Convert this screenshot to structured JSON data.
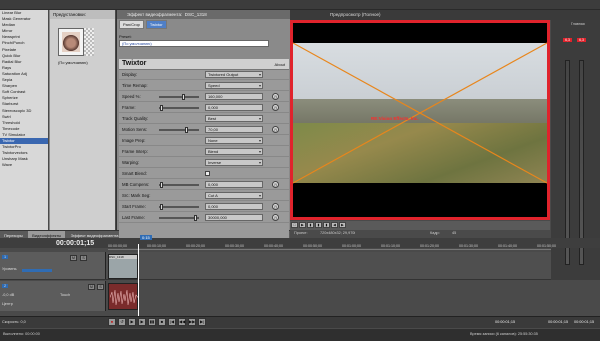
{
  "fx_list": {
    "items": [
      "Linear Blur",
      "Mask Generator",
      "Median",
      "Mirror",
      "Newsprint",
      "Pinch/Punch",
      "Pixelate",
      "Quick Blur",
      "Radial Blur",
      "Rays",
      "Saturation Adj",
      "Sepia",
      "Sharpen",
      "Soft Contrast",
      "Spherize",
      "Starburst",
      "Stereoscopic 3D",
      "Swirl",
      "Threshold",
      "Timecode",
      "TV Simulator",
      "Twixtor",
      "TwixtorPro",
      "Twixtorvectors",
      "Unsharp Mask",
      "Wave"
    ],
    "selected_index": 21
  },
  "presets_panel": {
    "header": "Предустановки:",
    "thumbnail_label": "(По умолчанию)"
  },
  "left_tabs": [
    "Перехоры",
    "Видеоэффекты",
    "Эффект видеофрагмента",
    "Обрезки"
  ],
  "plugin_panel": {
    "title_prefix": "Эффект видеофрагмента:",
    "title_clip": "DSC_1318",
    "chain": [
      "Pan/Crop",
      "Twixtor"
    ],
    "preset_label": "Preset:",
    "preset_value": "(По умолчанию)",
    "plugin_name": "Twixtor",
    "about_label": "About",
    "params": [
      {
        "label": "Display:",
        "value": "Twixtored Output",
        "type": "dropdown"
      },
      {
        "label": "Time Remap:",
        "value": "Speed",
        "type": "dropdown"
      },
      {
        "label": "Speed %:",
        "value": "160,000",
        "type": "slider",
        "fill": 0.62
      },
      {
        "label": "Frame:",
        "value": "0,000",
        "type": "slider",
        "fill": 0.03
      },
      {
        "label": "Track Quality:",
        "value": "Best",
        "type": "dropdown"
      },
      {
        "label": "Motion Sens:",
        "value": "70,00",
        "type": "slider",
        "fill": 0.7
      },
      {
        "label": "Image Prep:",
        "value": "None",
        "type": "dropdown"
      },
      {
        "label": "Frame Interp:",
        "value": "Blend",
        "type": "dropdown"
      },
      {
        "label": "Warping:",
        "value": "Inverse",
        "type": "dropdown"
      },
      {
        "label": "Smart Blend:",
        "value": "",
        "type": "checkbox"
      },
      {
        "label": "MB Compens:",
        "value": "0,000",
        "type": "slider",
        "fill": 0.03
      },
      {
        "label": "Src: Mark Seg:",
        "value": "Cut A",
        "type": "dropdown"
      },
      {
        "label": "Start Frame:",
        "value": "0,000",
        "type": "slider",
        "fill": 0.03
      },
      {
        "label": "Last Frame:",
        "value": "30000,000",
        "type": "slider",
        "fill": 0.95
      }
    ]
  },
  "preview": {
    "title": "Предпросмотр (Полное)",
    "watermark": "RE:Vision Effects, Inc.",
    "info_left_label": "Проект:",
    "info_left_value": "720x480x32; 29,970i",
    "info_left2_label": "Просмотр:",
    "info_left2_value": "720x480x32; 29,970i",
    "info_right_label": "Кадр:",
    "info_right_value": "45",
    "info_right2_label": "Отображение:",
    "info_right2_value": "394x263x32"
  },
  "meters": {
    "title": "Главная",
    "left_peak": "6,3",
    "right_peak": "6,3"
  },
  "timeline": {
    "timecode": "00:00:01;15",
    "marker": "0:15",
    "ruler": [
      "00:00:00;00",
      "00:00:10;00",
      "00:00:20;00",
      "00:00:30;00",
      "00:00:40;00",
      "00:00:50;00",
      "00:01:00;00",
      "00:01:10;00",
      "00:01:20;00",
      "00:01:30;00",
      "00:01:40;00",
      "00:01:50;00"
    ],
    "track1_number": "1",
    "track1_label": "Уровень",
    "track2_number": "2",
    "track2_volume": "-0,0 dB",
    "track2_mode": "Touch",
    "track2_pan": "Центр",
    "clip_video_name": "DSC_1318",
    "speed_label": "Скорость: 0,0"
  },
  "transport": {
    "timecode": "00:00:01;15",
    "end_timecode": "00:00:01;15",
    "length": "00:00:01;15"
  },
  "status": {
    "left": "Выполнено: 00:00:00",
    "right": "Время записи (6 каналов): 25:55:30:35"
  },
  "colors": {
    "highlight_red": "#e0232c",
    "selection_blue": "#3a67b0"
  }
}
